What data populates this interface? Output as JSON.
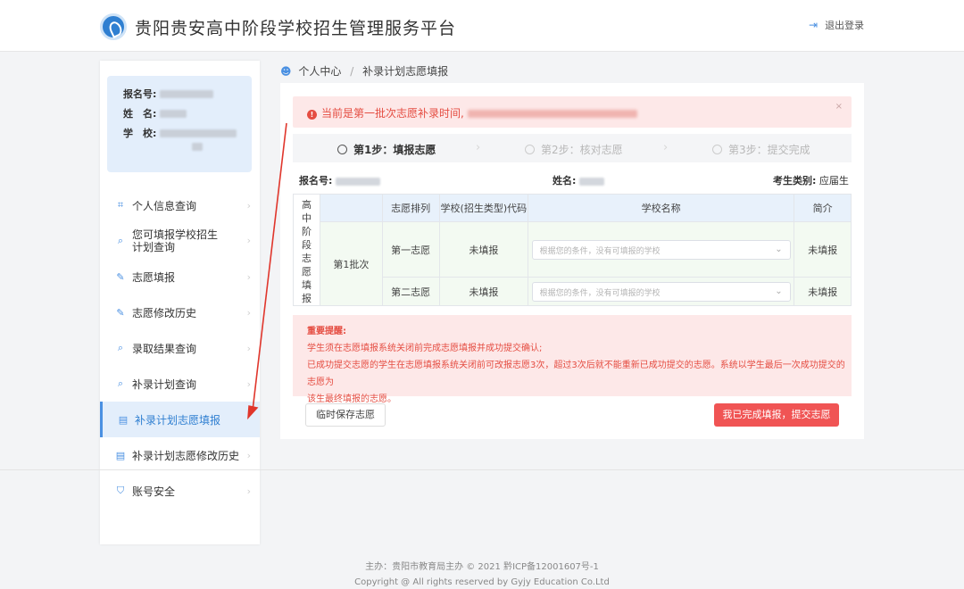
{
  "header": {
    "title": "贵阳贵安高中阶段学校招生管理服务平台",
    "logout_label": "退出登录"
  },
  "profile": {
    "reg_label": "报名号:",
    "name_label": "姓　名:",
    "school_label": "学　校:"
  },
  "sidebar": {
    "items": [
      {
        "label": "个人信息查询",
        "icon": "scan-icon"
      },
      {
        "label": "您可填报学校招生计划查询",
        "icon": "search-doc-icon"
      },
      {
        "label": "志愿填报",
        "icon": "edit-icon"
      },
      {
        "label": "志愿修改历史",
        "icon": "edit-icon"
      },
      {
        "label": "录取结果查询",
        "icon": "search-icon"
      },
      {
        "label": "补录计划查询",
        "icon": "search-icon"
      },
      {
        "label": "补录计划志愿填报",
        "icon": "form-icon"
      },
      {
        "label": "补录计划志愿修改历史",
        "icon": "form-icon"
      },
      {
        "label": "账号安全",
        "icon": "shield-icon"
      }
    ],
    "item1_line1": "您可填报学校招生",
    "item1_line2": "计划查询"
  },
  "breadcrumb": {
    "home": "个人中心",
    "sep": "/",
    "current": "补录计划志愿填报"
  },
  "alert": {
    "text": "当前是第一批次志愿补录时间,",
    "close": "×"
  },
  "steps": [
    {
      "label": "第1步：填报志愿"
    },
    {
      "label": "第2步：核对志愿"
    },
    {
      "label": "第3步：提交完成"
    }
  ],
  "info": {
    "reg_label": "报名号:",
    "name_label": "姓名:",
    "category_label": "考生类别:",
    "category_value": "应届生"
  },
  "table": {
    "side_label": "高中阶段志愿填报",
    "headers": [
      "志愿排列",
      "学校(招生类型)代码",
      "学校名称",
      "简介"
    ],
    "batch": "第1批次",
    "rows": [
      {
        "order": "第一志愿",
        "code": "未填报",
        "placeholder": "根据您的条件，没有可填报的学校",
        "intro": "未填报"
      },
      {
        "order": "第二志愿",
        "code": "未填报",
        "placeholder": "根据您的条件，没有可填报的学校",
        "intro": "未填报"
      }
    ]
  },
  "notice": {
    "title": "重要提醒:",
    "line1": "学生须在志愿填报系统关闭前完成志愿填报并成功提交确认;",
    "line2": "已成功提交志愿的学生在志愿填报系统关闭前可改报志愿3次，超过3次后就不能重新已成功提交的志愿。系统以学生最后一次成功提交的志愿为",
    "line3": "该生最终填报的志愿。"
  },
  "buttons": {
    "save": "临时保存志愿",
    "submit": "我已完成填报，提交志愿"
  },
  "footer": {
    "line1": "主办：贵阳市教育局主办 © 2021 黔ICP备12001607号-1",
    "line2": "Copyright @ All rights reserved by Gyjy Education Co.Ltd"
  },
  "colors": {
    "accent": "#4a90e2",
    "danger": "#f05454",
    "annotation_arrow": "#e0362c"
  }
}
